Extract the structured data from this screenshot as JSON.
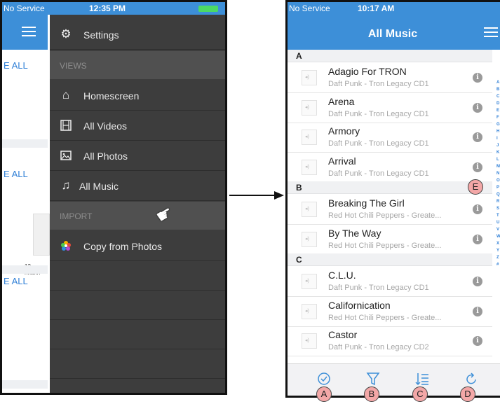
{
  "left_phone": {
    "status": {
      "carrier": "No Service",
      "time": "12:35 PM"
    },
    "background_see_all": [
      "E ALL",
      "E ALL",
      "E ALL"
    ],
    "thumb_caption": "13-rihann",
    "menu": {
      "settings": "Settings",
      "views_header": "VIEWS",
      "homescreen": "Homescreen",
      "all_videos": "All Videos",
      "all_photos": "All Photos",
      "all_music": "All Music",
      "import_header": "IMPORT",
      "copy_from_photos": "Copy from Photos"
    }
  },
  "right_phone": {
    "status": {
      "carrier": "No Service",
      "time": "10:17 AM"
    },
    "title": "All Music",
    "sections": [
      {
        "letter": "A",
        "songs": [
          {
            "title": "Adagio For TRON",
            "subtitle": "Daft Punk - Tron Legacy CD1"
          },
          {
            "title": "Arena",
            "subtitle": "Daft Punk - Tron Legacy CD1"
          },
          {
            "title": "Armory",
            "subtitle": "Daft Punk - Tron Legacy CD1"
          },
          {
            "title": "Arrival",
            "subtitle": "Daft Punk - Tron Legacy CD1"
          }
        ]
      },
      {
        "letter": "B",
        "songs": [
          {
            "title": "Breaking The Girl",
            "subtitle": "Red Hot Chili Peppers - Greate..."
          },
          {
            "title": "By The Way",
            "subtitle": "Red Hot Chili Peppers - Greate..."
          }
        ]
      },
      {
        "letter": "C",
        "songs": [
          {
            "title": "C.L.U.",
            "subtitle": "Daft Punk - Tron Legacy CD1"
          },
          {
            "title": "Californication",
            "subtitle": "Red Hot Chili Peppers - Greate..."
          },
          {
            "title": "Castor",
            "subtitle": "Daft Punk - Tron Legacy CD2"
          }
        ]
      }
    ],
    "index_letters": [
      "A",
      "B",
      "C",
      "D",
      "E",
      "F",
      "G",
      "H",
      "I",
      "J",
      "K",
      "L",
      "M",
      "N",
      "O",
      "P",
      "Q",
      "R",
      "S",
      "T",
      "U",
      "V",
      "W",
      "X",
      "Y",
      "Z",
      "#"
    ],
    "toolbar": [
      "select-icon",
      "filter-icon",
      "sort-icon",
      "refresh-icon"
    ]
  },
  "callouts": {
    "a": "A",
    "b": "B",
    "c": "C",
    "d": "D",
    "e": "E"
  },
  "colors": {
    "accent": "#3d8fd8",
    "menu_bg": "#3d3d3d",
    "badge": "#f3a7a7"
  }
}
